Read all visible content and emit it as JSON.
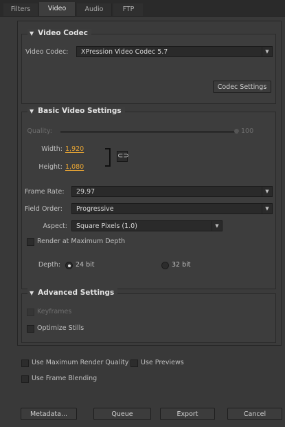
{
  "tabs": [
    {
      "label": "Filters",
      "active": false
    },
    {
      "label": "Video",
      "active": true
    },
    {
      "label": "Audio",
      "active": false
    },
    {
      "label": "FTP",
      "active": false
    }
  ],
  "video_codec": {
    "section_title": "Video Codec",
    "label": "Video Codec:",
    "value": "XPression Video Codec 5.7",
    "settings_button": "Codec Settings"
  },
  "basic": {
    "section_title": "Basic Video Settings",
    "quality_label": "Quality:",
    "quality_value": "100",
    "quality_fraction": 1.0,
    "width_label": "Width:",
    "width_value": "1,920",
    "height_label": "Height:",
    "height_value": "1,080",
    "link_icon": "chain-link-icon",
    "frame_rate_label": "Frame Rate:",
    "frame_rate_value": "29.97",
    "field_order_label": "Field Order:",
    "field_order_value": "Progressive",
    "aspect_label": "Aspect:",
    "aspect_value": "Square Pixels (1.0)",
    "render_max_depth_label": "Render at Maximum Depth",
    "depth_label": "Depth:",
    "depth_24": "24 bit",
    "depth_32": "32 bit"
  },
  "advanced": {
    "section_title": "Advanced Settings",
    "keyframes_label": "Keyframes",
    "optimize_stills_label": "Optimize Stills"
  },
  "options": {
    "max_render_quality": "Use Maximum Render Quality",
    "use_previews": "Use Previews",
    "frame_blending": "Use Frame Blending"
  },
  "footer": {
    "metadata": "Metadata...",
    "queue": "Queue",
    "export": "Export",
    "cancel": "Cancel"
  },
  "colors": {
    "accent_value": "#e8a534",
    "background": "#393939"
  }
}
